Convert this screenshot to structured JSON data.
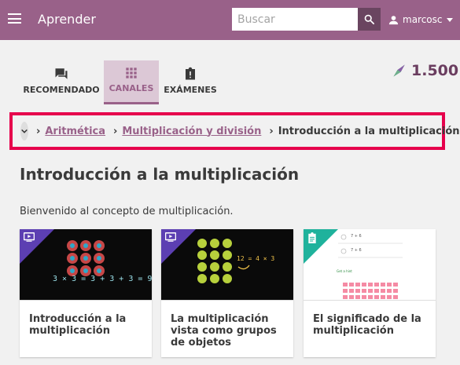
{
  "header": {
    "app_title": "Aprender",
    "search_placeholder": "Buscar",
    "username": "marcosc"
  },
  "tabs": [
    {
      "label": "RECOMENDADO",
      "icon": "forum-icon",
      "active": false
    },
    {
      "label": "CANALES",
      "icon": "apps-grid-icon",
      "active": true
    },
    {
      "label": "EXÁMENES",
      "icon": "exam-icon",
      "active": false
    }
  ],
  "points": {
    "value": "1.500",
    "icon": "points-icon",
    "color": "#6a3d5f"
  },
  "breadcrumb": {
    "items": [
      "Aritmética",
      "Multiplicación y división"
    ],
    "current": "Introducción a la multiplicación"
  },
  "page": {
    "title": "Introducción a la multiplicación",
    "description": "Bienvenido al concepto de multiplicación."
  },
  "cards": [
    {
      "title": "Introducción a la multiplicación",
      "kind": "video",
      "thumb_text": "3 × 3 = 3 + 3 + 3 = 9"
    },
    {
      "title": "La multiplicación vista como grupos de objetos",
      "kind": "video",
      "thumb_text": "12 = 4 × 3"
    },
    {
      "title": "El significado de la multiplicación",
      "kind": "exercise",
      "thumb_lines": [
        "7 + 6",
        "7 + 6"
      ],
      "thumb_button": "Get a hint"
    }
  ],
  "colors": {
    "brand": "#996189",
    "brand_dark": "#6a4560",
    "highlight_border": "#e6004c",
    "video_corner": "#5c3fb2",
    "exercise_corner": "#1fb29c"
  }
}
